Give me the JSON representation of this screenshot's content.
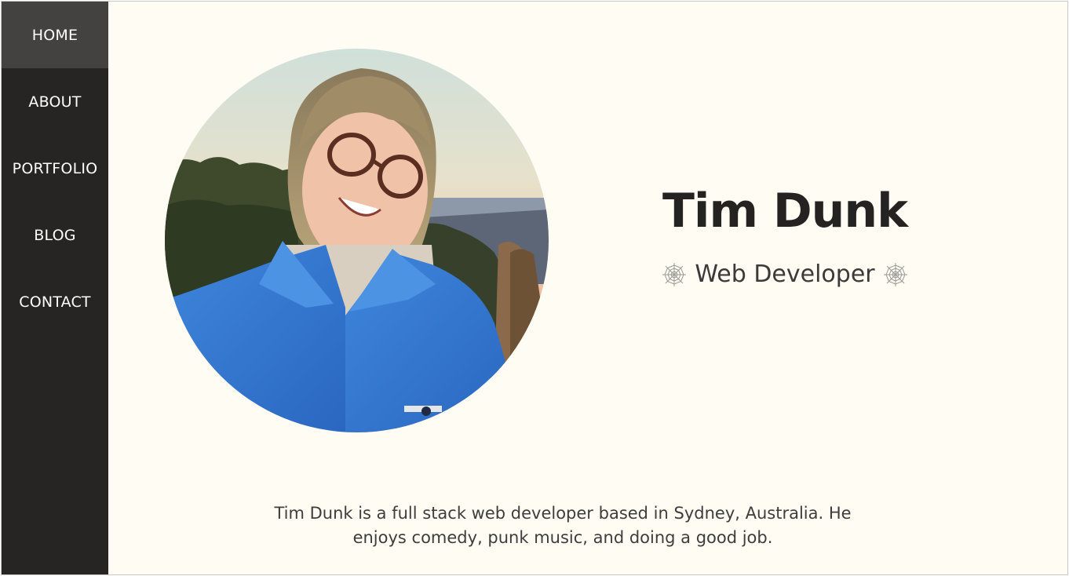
{
  "nav": {
    "items": [
      {
        "label": "HOME",
        "active": true
      },
      {
        "label": "ABOUT",
        "active": false
      },
      {
        "label": "PORTFOLIO",
        "active": false
      },
      {
        "label": "BLOG",
        "active": false
      },
      {
        "label": "CONTACT",
        "active": false
      }
    ]
  },
  "hero": {
    "name": "Tim Dunk",
    "role": "Web Developer",
    "decor_icon": "spiderweb-icon"
  },
  "bio": {
    "line1": "Tim Dunk is a full stack web developer based in Sydney, Australia. He",
    "line2": "enjoys comedy, punk music, and doing a good job."
  },
  "colors": {
    "sidebar": "#262524",
    "sidebar_active": "#434240",
    "background": "#fefcf3",
    "text_dark": "#242321"
  }
}
